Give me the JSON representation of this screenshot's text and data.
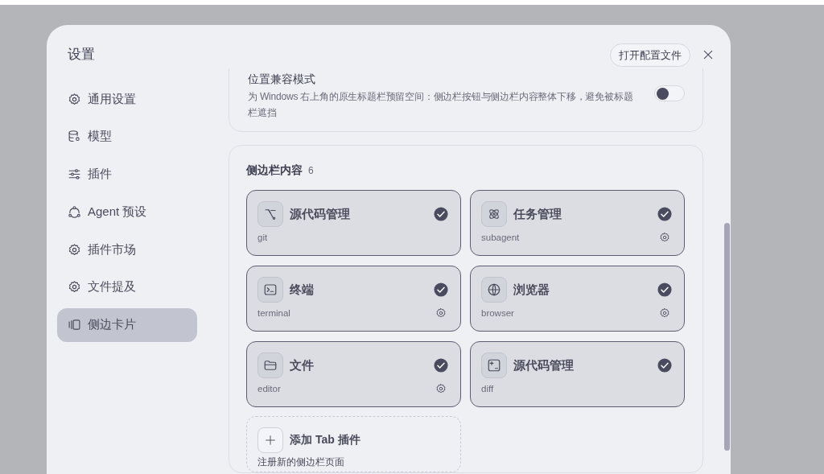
{
  "dialog": {
    "title": "设置",
    "open_config_button": "打开配置文件"
  },
  "nav": [
    {
      "label": "通用设置",
      "selected": false
    },
    {
      "label": "模型",
      "selected": false
    },
    {
      "label": "插件",
      "selected": false
    },
    {
      "label": "Agent 预设",
      "selected": false
    },
    {
      "label": "插件市场",
      "selected": false
    },
    {
      "label": "文件提及",
      "selected": false
    },
    {
      "label": "侧边卡片",
      "selected": true
    }
  ],
  "sections": [
    {
      "kind": "toggle",
      "title": "位置兼容模式",
      "description": "为 Windows 右上角的原生标题栏预留空间：侧边栏按钮与侧边栏内容整体下移，避免被标题栏遮挡",
      "on": false
    },
    {
      "kind": "cards",
      "title": "侧边栏内容",
      "count": "6",
      "cards": [
        {
          "title": "源代码管理",
          "subtitle": "git",
          "checked": true,
          "has_settings": false
        },
        {
          "title": "任务管理",
          "subtitle": "subagent",
          "checked": true,
          "has_settings": true
        },
        {
          "title": "终端",
          "subtitle": "terminal",
          "checked": true,
          "has_settings": true
        },
        {
          "title": "浏览器",
          "subtitle": "browser",
          "checked": true,
          "has_settings": true
        },
        {
          "title": "文件",
          "subtitle": "editor",
          "checked": true,
          "has_settings": true
        },
        {
          "title": "源代码管理",
          "subtitle": "diff",
          "checked": true,
          "has_settings": false
        }
      ],
      "add_card": {
        "title": "添加 Tab 插件",
        "description": "注册新的侧边栏页面"
      }
    }
  ]
}
